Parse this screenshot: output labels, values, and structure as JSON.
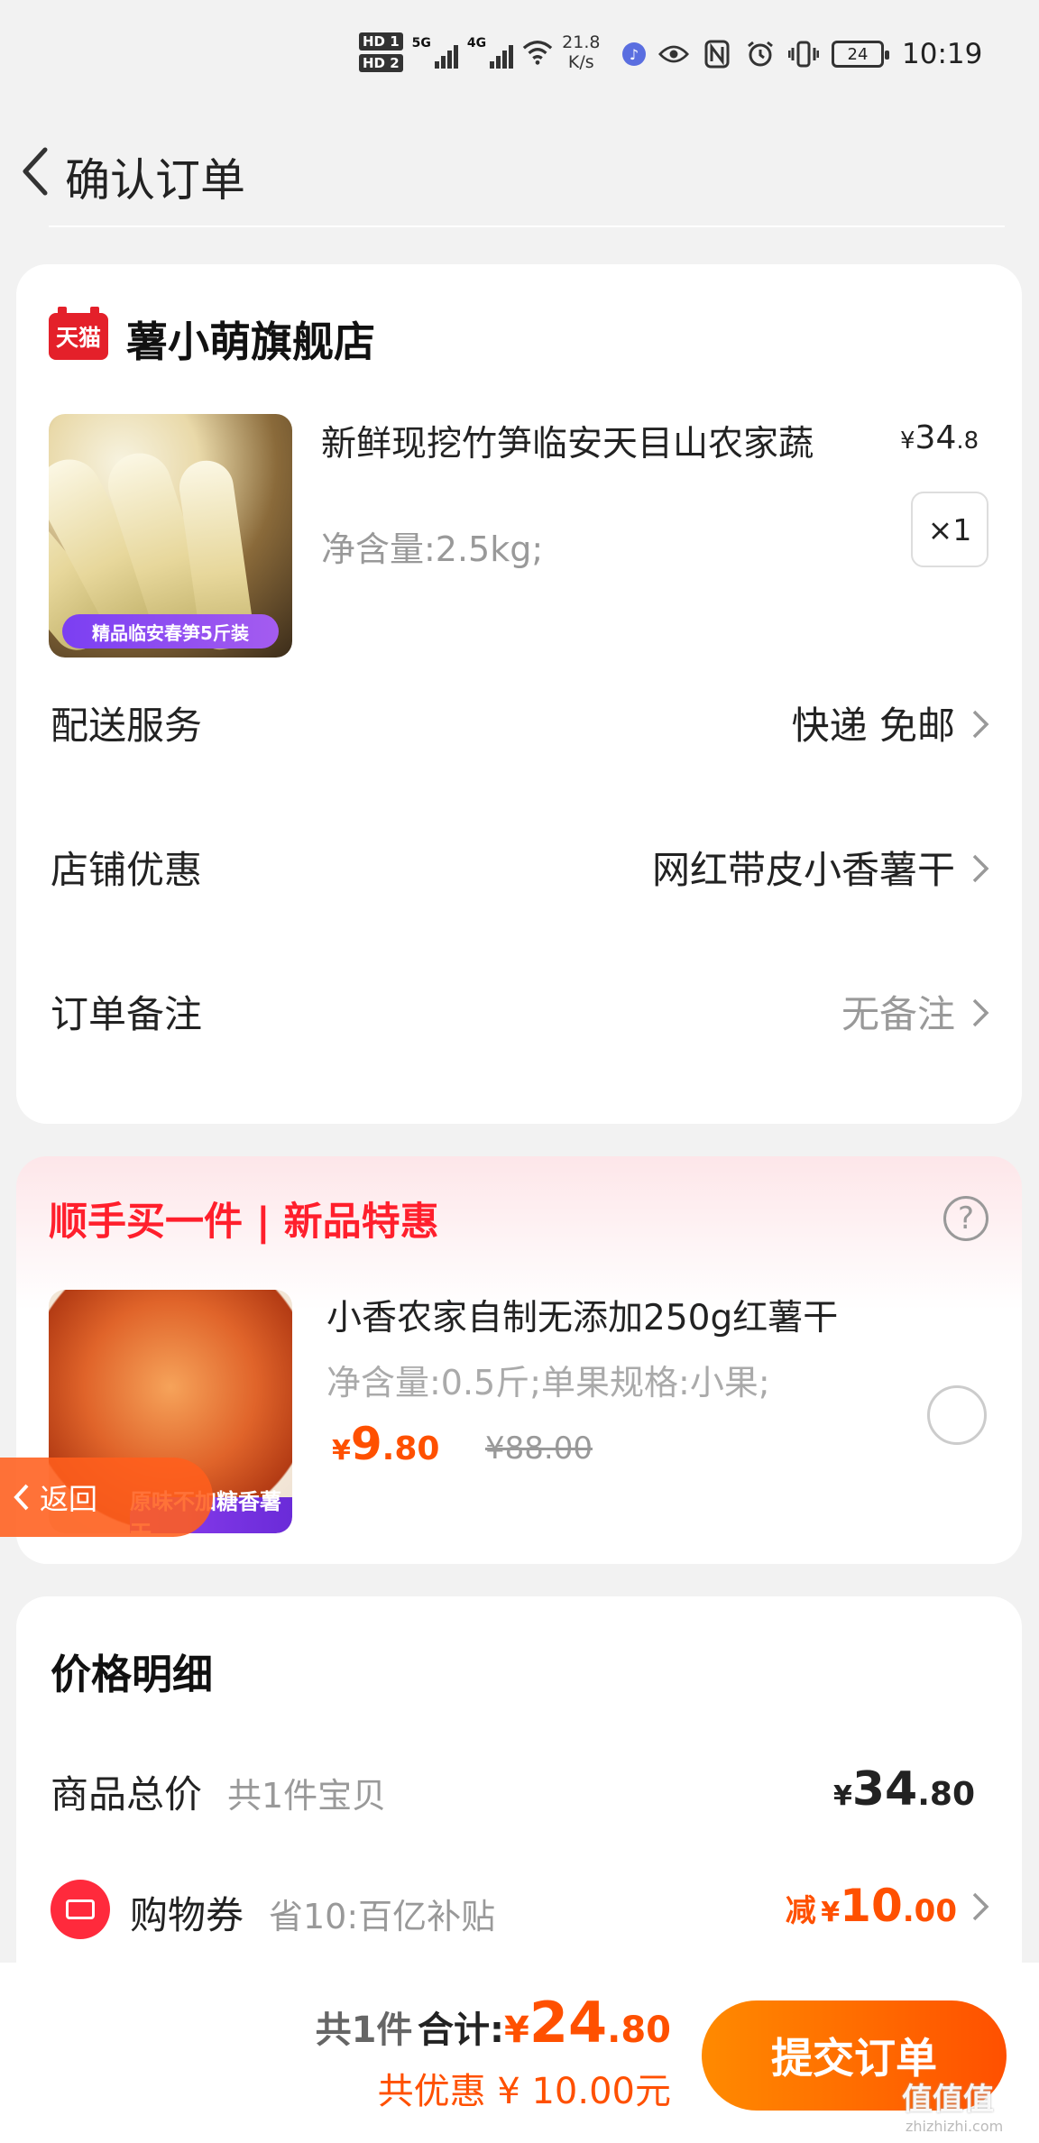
{
  "status_bar": {
    "hd1": "HD 1",
    "hd2": "HD 2",
    "net1": "5G",
    "net2": "4G",
    "speed_value": "21.8",
    "speed_unit": "K/s",
    "battery": "24",
    "time": "10:19"
  },
  "header": {
    "title": "确认订单"
  },
  "store": {
    "badge": "天猫",
    "name": "薯小萌旗舰店",
    "product": {
      "title": "新鲜现挖竹笋临安天目山农家蔬",
      "price_symbol": "¥",
      "price_int": "34",
      "price_dec": ".8",
      "spec": "净含量:2.5kg;",
      "quantity": "×1",
      "image_label": "精品临安春笋5斤装"
    },
    "rows": [
      {
        "label": "配送服务",
        "value": "快递 免邮"
      },
      {
        "label": "店铺优惠",
        "value": "网红带皮小香薯干"
      },
      {
        "label": "订单备注",
        "value": "无备注"
      }
    ]
  },
  "addon": {
    "title": "顺手买一件 | 新品特惠",
    "help": "?",
    "name": "小香农家自制无添加250g红薯干",
    "spec": "净含量:0.5斤;单果规格:小果;",
    "price_symbol": "¥",
    "price_int": "9",
    "price_dec": ".80",
    "original_price": "¥88.00",
    "image_label": "原味不加糖香薯干"
  },
  "float_back": {
    "label": "返回"
  },
  "price_detail": {
    "title": "价格明细",
    "goods_label": "商品总价",
    "goods_sub": "共1件宝贝",
    "goods_symbol": "¥",
    "goods_int": "34",
    "goods_dec": ".80",
    "coupon_label": "购物券",
    "coupon_sub": "省10:百亿补贴",
    "coupon_prefix": "减",
    "coupon_symbol": "¥",
    "coupon_int": "10",
    "coupon_dec": ".00"
  },
  "bottom_bar": {
    "count": "共1件",
    "total_label": "合计:",
    "total_symbol": "¥",
    "total_int": "24",
    "total_dec": ".80",
    "saving": "共优惠 ¥ 10.00元",
    "submit": "提交订单"
  },
  "watermark": {
    "text": "值值值",
    "site": "zhizhizhi.com"
  },
  "colors": {
    "accent_orange": "#ff5000",
    "tmall_red": "#e4202a",
    "addon_red": "#ff1f2c"
  }
}
